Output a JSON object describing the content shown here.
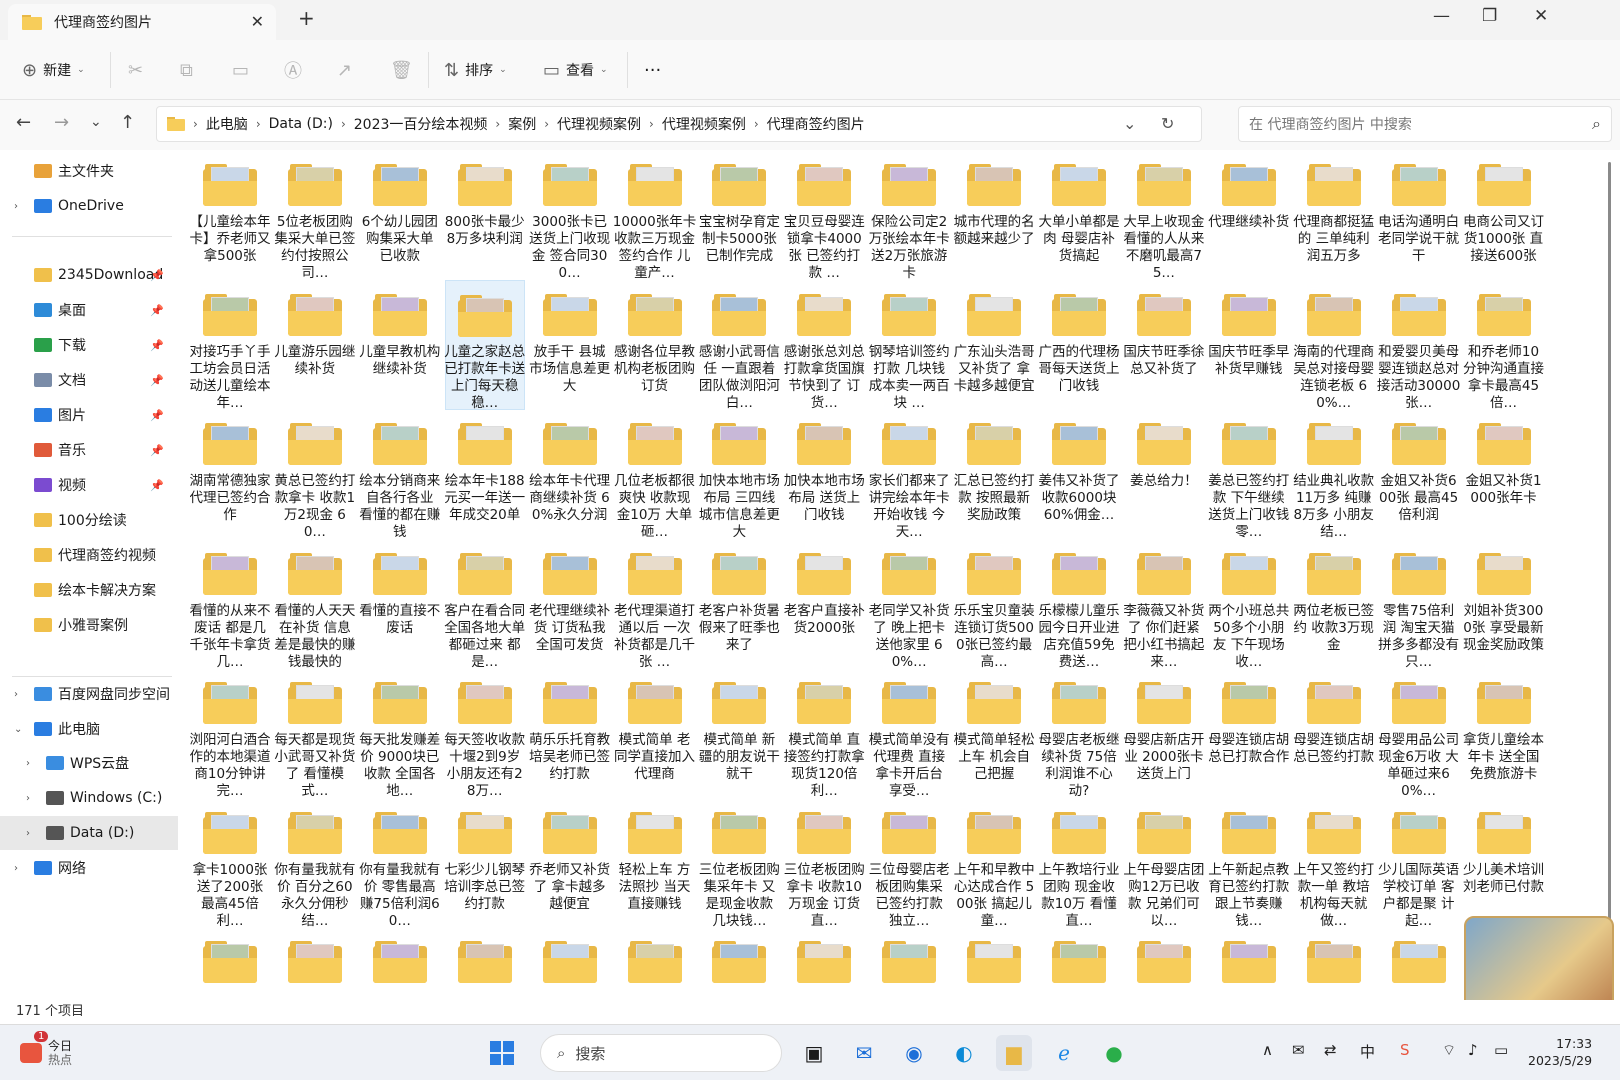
{
  "window": {
    "tab_title": "代理商签约图片",
    "close": "✕",
    "new_tab": "+",
    "minimize": "—",
    "maximize": "❐",
    "close_window": "✕"
  },
  "toolbar": {
    "new_label": "新建",
    "sort_label": "排序",
    "view_label": "查看",
    "more": "···"
  },
  "nav": {
    "back": "←",
    "forward": "→",
    "down": "⌄",
    "up": "↑",
    "refresh": "↻",
    "dropdown": "⌄"
  },
  "breadcrumb": [
    "此电脑",
    "Data (D:)",
    "2023一百分绘本视频",
    "案例",
    "代理视频案例",
    "代理视频案例",
    "代理商签约图片"
  ],
  "search": {
    "placeholder": "在 代理商签约图片 中搜索"
  },
  "sidebar": [
    {
      "label": "主文件夹",
      "icon": "home-icon",
      "pin": false,
      "arrow": ""
    },
    {
      "label": "OneDrive",
      "icon": "cloud-icon",
      "pin": false,
      "arrow": "›"
    },
    {
      "label": "2345Download",
      "icon": "folder-icon",
      "pin": true,
      "arrow": ""
    },
    {
      "label": "桌面",
      "icon": "desktop-icon",
      "pin": true,
      "arrow": ""
    },
    {
      "label": "下载",
      "icon": "download-icon",
      "pin": true,
      "arrow": ""
    },
    {
      "label": "文档",
      "icon": "document-icon",
      "pin": true,
      "arrow": ""
    },
    {
      "label": "图片",
      "icon": "picture-icon",
      "pin": true,
      "arrow": ""
    },
    {
      "label": "音乐",
      "icon": "music-icon",
      "pin": true,
      "arrow": ""
    },
    {
      "label": "视频",
      "icon": "video-icon",
      "pin": true,
      "arrow": ""
    },
    {
      "label": "100分绘读",
      "icon": "folder-icon",
      "pin": false,
      "arrow": ""
    },
    {
      "label": "代理商签约视频",
      "icon": "folder-icon",
      "pin": false,
      "arrow": ""
    },
    {
      "label": "绘本卡解决方案",
      "icon": "folder-icon",
      "pin": false,
      "arrow": ""
    },
    {
      "label": "小雅哥案例",
      "icon": "folder-icon",
      "pin": false,
      "arrow": ""
    },
    {
      "label": "百度网盘同步空间",
      "icon": "baidu-cloud-icon",
      "pin": false,
      "arrow": "›"
    },
    {
      "label": "此电脑",
      "icon": "computer-icon",
      "pin": false,
      "arrow": "⌄"
    },
    {
      "label": "WPS云盘",
      "icon": "wps-cloud-icon",
      "pin": false,
      "arrow": "›"
    },
    {
      "label": "Windows (C:)",
      "icon": "drive-icon",
      "pin": false,
      "arrow": "›"
    },
    {
      "label": "Data (D:)",
      "icon": "drive-icon",
      "pin": false,
      "arrow": "›"
    },
    {
      "label": "网络",
      "icon": "network-icon",
      "pin": false,
      "arrow": "›"
    }
  ],
  "pin_glyph": "📌",
  "items": [
    "【儿童绘本年卡】乔老师又拿500张",
    "5位老板团购集采大单已签约付按照公司…",
    "6个幼儿园团购集采大单 已收款",
    "800张卡最少8万多块利润",
    "3000张卡已送货上门收现金 签合同300…",
    "10000张年卡收款三万现金签约合作 儿童产…",
    "宝宝树孕育定制卡5000张已制作完成",
    "宝贝豆母婴连锁拿卡4000张 已签约打款 …",
    "保险公司定2万张绘本年卡送2万张旅游卡",
    "城市代理的名额越来越少了",
    "大单小单都是肉 母婴店补货搞起",
    "大早上收现金 看懂的人从来不磨叽最高75…",
    "代理继续补货",
    "代理商都挺猛的 三单纯利润五万多",
    "电话沟通明白 老同学说干就干",
    "电商公司又订货1000张 直接送600张",
    "对接巧手丫手工坊会员日活动送儿童绘本年…",
    "儿童游乐园继续补货",
    "儿童早教机构继续补货",
    "儿童之家赵总已打款年卡送上门每天稳稳…",
    "放手干 县城市场信息差更大",
    "感谢各位早教机构老板团购订货",
    "感谢小武哥信任 一直跟着团队做浏阳河白…",
    "感谢张总刘总打款拿货国旗节快到了 订货…",
    "钢琴培训签约打款 几块钱成本卖一两百块 …",
    "广东汕头浩哥又补货了 拿卡越多越便宜",
    "广西的代理杨哥每天送货上门收钱",
    "国庆节旺季徐总又补货了",
    "国庆节旺季早补货早赚钱",
    "海南的代理商吴总对接母婴连锁老板 60%…",
    "和爱婴贝美母婴连锁赵总对接活动30000张…",
    "和乔老师10分钟沟通直接拿卡最高45倍…",
    "湖南常德独家代理已签约合作",
    "黄总已签约打款拿卡 收款1万2现金 60…",
    "绘本分销商来自各行各业 看懂的都在赚钱",
    "绘本年卡188元买一年送一年成交20单",
    "绘本年卡代理商继续补货 60%永久分润",
    "几位老板都很爽快 收款现金10万 大单砸…",
    "加快本地市场布局 三四线城市信息差更大",
    "加快本地市场布局 送货上门收钱",
    "家长们都来了 讲完绘本年卡开始收钱 今天…",
    "汇总已签约打款 按照最新奖励政策",
    "姜伟又补货了 收款6000块 60%佣金…",
    "姜总给力！",
    "姜总已签约打款 下午继续送货上门收钱 零…",
    "结业典礼收款11万多 纯赚8万多 小朋友结…",
    "金姐又补货600张 最高45倍利润",
    "金姐又补货1000张年卡",
    "看懂的从来不废话 都是几千张年卡拿货几…",
    "看懂的人天天在补货 信息差是最快的赚钱最快的",
    "看懂的直接不废话",
    "客户在看合同 全国各地大单都砸过来 都是…",
    "老代理继续补货 订货私我全国可发货",
    "老代理渠道打通以后 一次补货都是几千张 …",
    "老客户补货暑假来了旺季也来了",
    "老客户直接补货2000张",
    "老同学又补货了 晚上把卡送他家里 60%…",
    "乐乐宝贝童装连锁订货5000张已签约最高…",
    "乐檬檬儿童乐园今日开业进店充值59免费送…",
    "李薇薇又补货了 你们赶紧把小红书搞起来…",
    "两个小班总共50多个小朋友 下午现场收…",
    "两位老板已签约 收款3万现金",
    "零售75倍利润 淘宝天猫拼多多都没有只…",
    "刘姐补货3000张 享受最新现金奖励政策",
    "浏阳河白酒合作的本地渠道商10分钟讲完…",
    "每天都是现货 小武哥又补货了 看懂模式…",
    "每天批发赚差价 9000块已收款 全国各地…",
    "每天签收收款 十堰2到9岁小朋友还有28万…",
    "萌乐乐托育教培吴老师已签约打款",
    "模式简单 老同学直接加入代理商",
    "模式简单 新疆的朋友说干就干",
    "模式简单 直接签约打款拿现货120倍利…",
    "模式简单没有代理费 直接拿卡开后台 享受…",
    "模式简单轻松上车 机会自己把握",
    "母婴店老板继续补货 75倍利润谁不心动?",
    "母婴店新店开业 2000张卡送货上门",
    "母婴连锁店胡总已打款合作",
    "母婴连锁店胡总已签约打款",
    "母婴用品公司现金6万收 大单砸过来60%…",
    "拿货儿童绘本年卡 送全国免费旅游卡",
    "拿卡1000张 送了200张 最高45倍利…",
    "你有量我就有价 百分之60永久分佣秒结…",
    "你有量我就有价 零售最高赚75倍利润60…",
    "七彩少儿钢琴培训李总已签约打款",
    "乔老师又补货了 拿卡越多越便宜",
    "轻松上车 方法照抄 当天直接赚钱",
    "三位老板团购集采年卡 又是现金收款 几块钱…",
    "三位老板团购拿卡 收款10万现金 订货直…",
    "三位母婴店老板团购集采 已签约打款 独立…",
    "上午和早教中心达成合作 500张 搞起儿童…",
    "上午教培行业团购 现金收款10万 看懂直…",
    "上午母婴店团购12万已收款 兄弟们可以…",
    "上午新起点教育已签约打款 跟上节奏赚钱…",
    "上午又签约打款一单 教培机构每天就做…",
    "少儿国际英语学校订单 客户都是聚 计起…",
    "少儿美术培训刘老师已付款"
  ],
  "partial_row": 16,
  "status": {
    "count": "171 个项目"
  },
  "taskbar": {
    "news_title": "今日",
    "news_sub": "热点",
    "badge": "1",
    "search_label": "搜索",
    "time": "17:33",
    "date": "2023/5/29",
    "ime": "中"
  },
  "colors": {
    "folder_back": "#e8b847",
    "folder_front": "#f7cd5a",
    "accent": "#0067c0"
  }
}
